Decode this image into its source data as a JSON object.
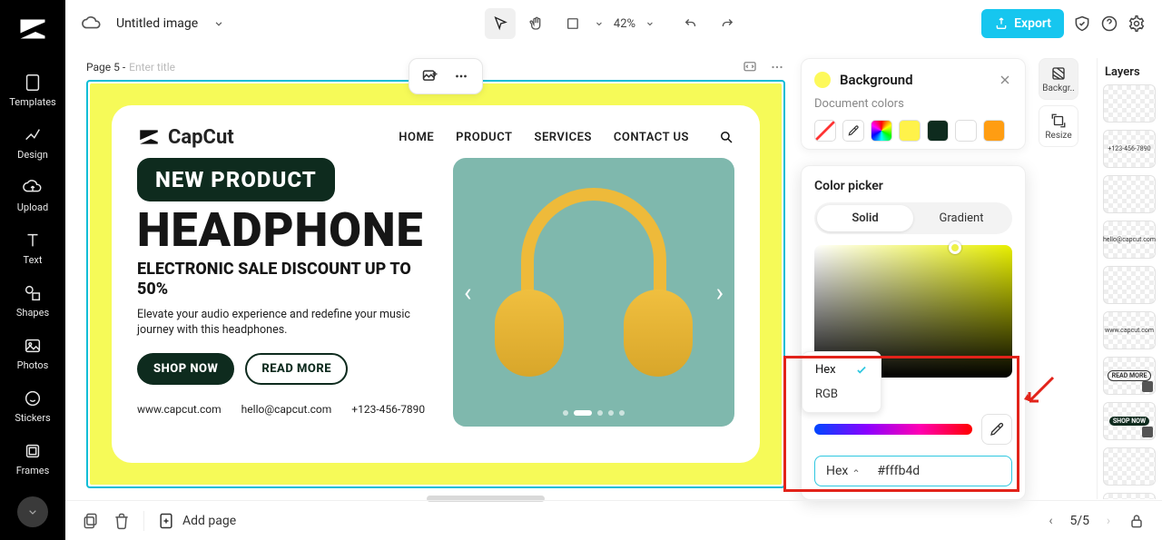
{
  "app": {
    "name": "CapCut"
  },
  "doc": {
    "title": "Untitled image"
  },
  "toolbar": {
    "zoom": "42%",
    "export": "Export"
  },
  "rail": {
    "templates": "Templates",
    "design": "Design",
    "upload": "Upload",
    "text": "Text",
    "shapes": "Shapes",
    "photos": "Photos",
    "stickers": "Stickers",
    "frames": "Frames"
  },
  "page": {
    "label": "Page 5  -",
    "placeholder": "Enter title"
  },
  "card": {
    "brand": "CapCut",
    "nav": {
      "home": "HOME",
      "product": "PRODUCT",
      "services": "SERVICES",
      "contact": "CONTACT US"
    },
    "badge": "NEW PRODUCT",
    "headline": "HEADPHONE",
    "subline": "ELECTRONIC SALE DISCOUNT UP TO 50%",
    "desc": "Elevate your audio experience and redefine your music journey with this headphones.",
    "cta_primary": "SHOP NOW",
    "cta_secondary": "READ MORE",
    "footer": {
      "site": "www.capcut.com",
      "email": "hello@capcut.com",
      "phone": "+123-456-7890"
    }
  },
  "panel": {
    "title": "Background",
    "doc_colors_label": "Document colors",
    "swatches": [
      "#ffffff00",
      "eyedropper",
      "rainbow",
      "#fff24a",
      "#0e2b1e",
      "#ffffff",
      "#ff9d12"
    ]
  },
  "picker": {
    "title": "Color picker",
    "tab_solid": "Solid",
    "tab_gradient": "Gradient",
    "format_options": {
      "hex": "Hex",
      "rgb": "RGB"
    },
    "hex_label": "Hex",
    "hex_value": "#fffb4d"
  },
  "right_tools": {
    "background": "Backgr..",
    "resize": "Resize"
  },
  "layers": {
    "title": "Layers",
    "items": [
      "",
      "+123-456-7890",
      "",
      "hello@capcut.com",
      "",
      "www.capcut.com",
      "READ MORE",
      "SHOP NOW",
      "",
      ""
    ]
  },
  "bottom": {
    "add_page": "Add page",
    "page_indicator": "5/5"
  }
}
